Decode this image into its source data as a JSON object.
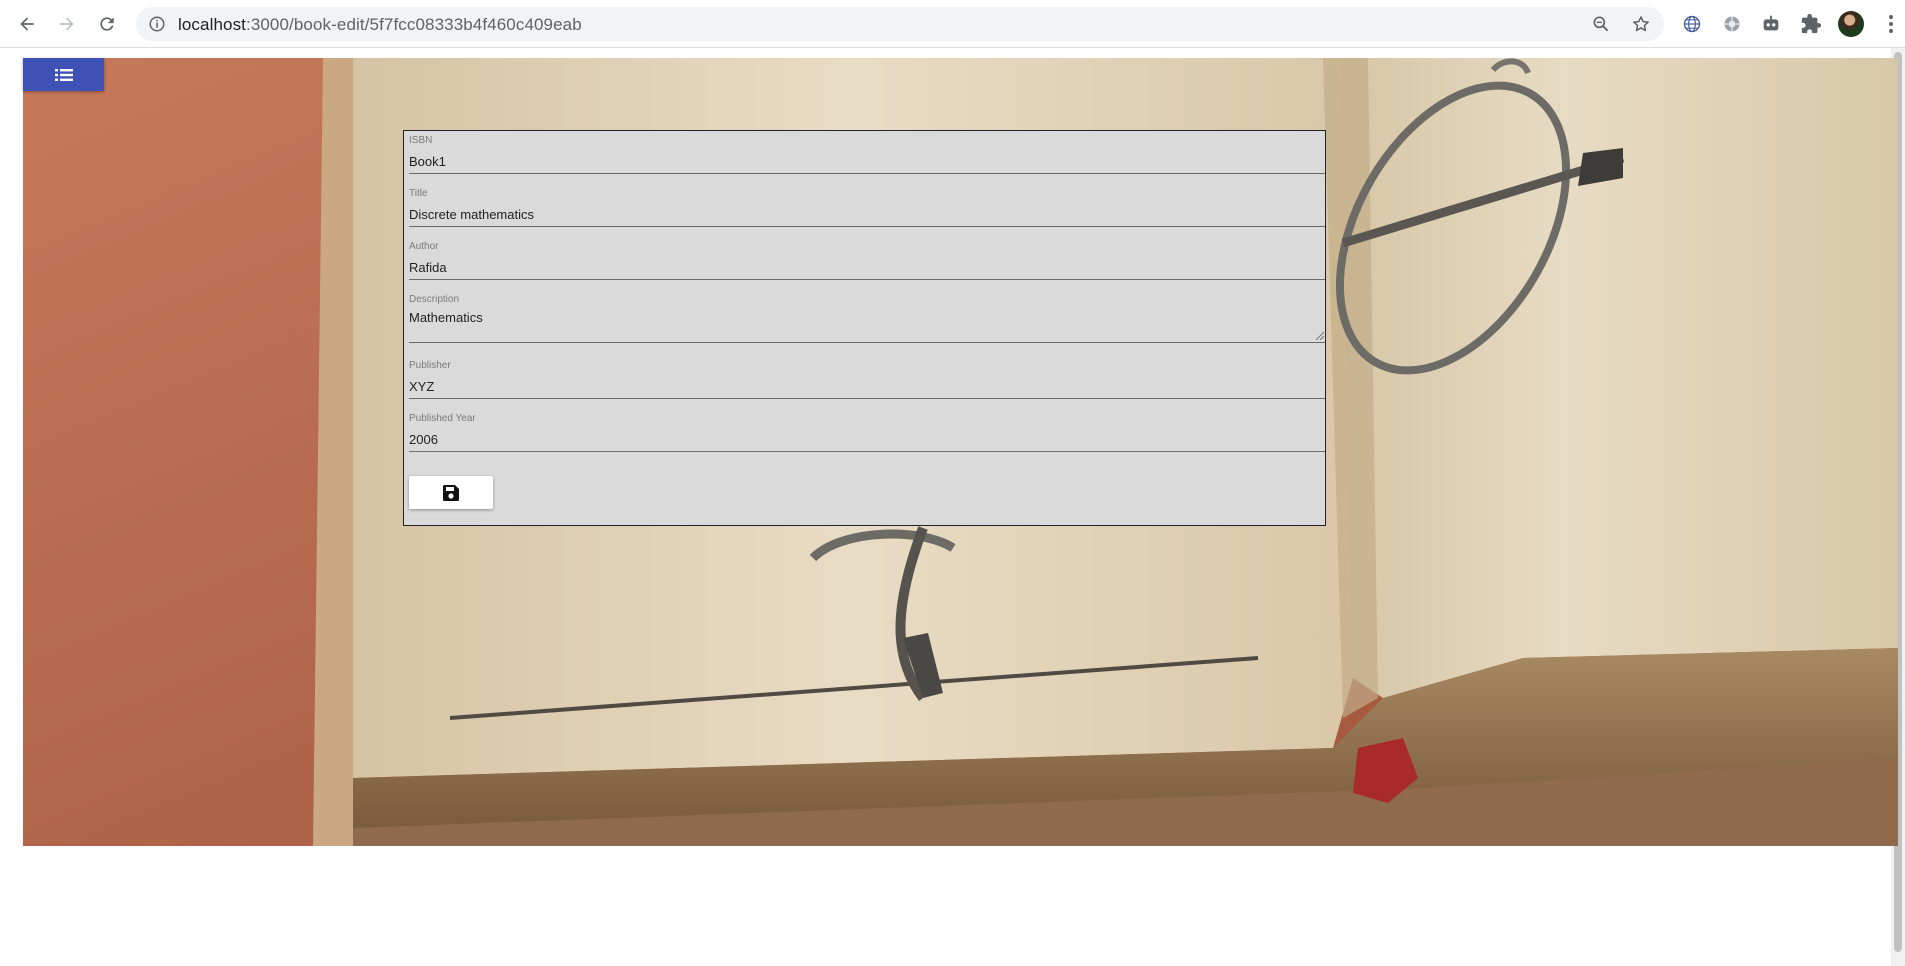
{
  "browser": {
    "url_host": "localhost",
    "url_path": ":3000/book-edit/5f7fcc08333b4f460c409eab",
    "icons": [
      "back-icon",
      "forward-icon",
      "reload-icon",
      "info-icon",
      "zoom-icon",
      "star-icon",
      "extension-icon",
      "puzzle-icon",
      "profile-avatar",
      "menu-icon"
    ]
  },
  "page": {
    "menu_icon": "list-icon",
    "menu_color": "#3f51b5",
    "form_background": "#dadada"
  },
  "form": {
    "isbn": {
      "label": "ISBN",
      "value": "Book1"
    },
    "title": {
      "label": "Title",
      "value": "Discrete mathematics"
    },
    "author": {
      "label": "Author",
      "value": "Rafida"
    },
    "description": {
      "label": "Description",
      "value": "Mathematics"
    },
    "publisher": {
      "label": "Publisher",
      "value": "XYZ"
    },
    "published_year": {
      "label": "Published Year",
      "value": "2006"
    },
    "save_icon": "floppy-disk-icon"
  }
}
